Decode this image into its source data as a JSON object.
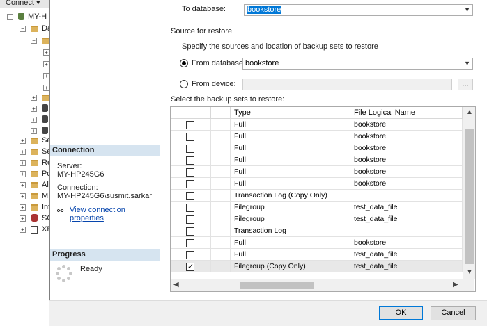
{
  "explorer": {
    "connect_label": "Connect ▾",
    "server_node": "MY-H",
    "databases_node": "Da",
    "folder_items": [
      {
        "label": "Se"
      },
      {
        "label": "Se"
      },
      {
        "label": "Re"
      },
      {
        "label": "Po"
      },
      {
        "label": "Al"
      },
      {
        "label": "M"
      },
      {
        "label": "Int"
      },
      {
        "label": "SC"
      },
      {
        "label": "XE"
      }
    ]
  },
  "left_pane": {
    "connection_header": "Connection",
    "server_label": "Server:",
    "server_value": "MY-HP245G6",
    "connection_label": "Connection:",
    "connection_value": "MY-HP245G6\\susmit.sarkar",
    "view_connection_link": "View connection properties",
    "progress_header": "Progress",
    "progress_status": "Ready"
  },
  "form": {
    "to_database_label": "To database:",
    "to_database_value": "bookstore",
    "source_header": "Source for restore",
    "source_instruction": "Specify the sources and location of backup sets to restore",
    "from_database_label": "From database:",
    "from_database_value": "bookstore",
    "from_device_label": "From device:",
    "browse_label": "...",
    "backup_sets_label": "Select the backup sets to restore:"
  },
  "grid": {
    "columns": [
      "Type",
      "File Logical Name"
    ],
    "rows": [
      {
        "checked": false,
        "type": "Full",
        "file": "bookstore"
      },
      {
        "checked": false,
        "type": "Full",
        "file": "bookstore"
      },
      {
        "checked": false,
        "type": "Full",
        "file": "bookstore"
      },
      {
        "checked": false,
        "type": "Full",
        "file": "bookstore"
      },
      {
        "checked": false,
        "type": "Full",
        "file": "bookstore"
      },
      {
        "checked": false,
        "type": "Full",
        "file": "bookstore"
      },
      {
        "checked": false,
        "type": "Transaction Log (Copy Only)",
        "file": ""
      },
      {
        "checked": false,
        "type": "Filegroup",
        "file": "test_data_file"
      },
      {
        "checked": false,
        "type": "Filegroup",
        "file": "test_data_file"
      },
      {
        "checked": false,
        "type": "Transaction Log",
        "file": ""
      },
      {
        "checked": false,
        "type": "Full",
        "file": "bookstore"
      },
      {
        "checked": false,
        "type": "Full",
        "file": "test_data_file"
      },
      {
        "checked": true,
        "type": "Filegroup (Copy Only)",
        "file": "test_data_file"
      }
    ]
  },
  "buttons": {
    "ok": "OK",
    "cancel": "Cancel"
  },
  "colors": {
    "section_header_bg": "#d6e4f0",
    "selection_highlight": "#0078d7",
    "link": "#0645ad"
  }
}
